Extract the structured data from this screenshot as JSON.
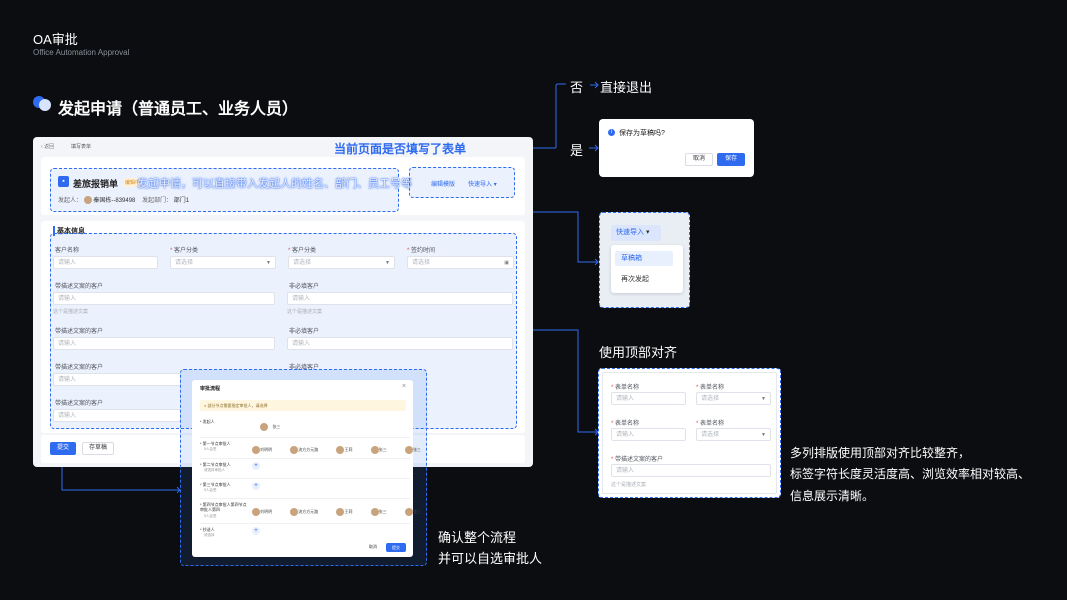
{
  "header": {
    "title": "OA审批",
    "subtitle": "Office Automation Approval"
  },
  "section": {
    "title": "发起申请（普通员工、业务人员）"
  },
  "annotations": {
    "current_page_question": "当前页面是否填写了表单",
    "no_label": "否",
    "no_action": "直接退出",
    "yes_label": "是",
    "top_align": "使用顶部对齐",
    "top_align_desc_1": "多列排版使用顶部对齐比较整齐，",
    "top_align_desc_2": "标签字符长度灵活度高、浏览效率相对较高、",
    "top_align_desc_3": "信息展示清晰。",
    "confirm_flow_1": "确认整个流程",
    "confirm_flow_2": "并可以自选审批人",
    "auto_fill_note": "发起申请，可以直接带入发起人的姓名、部门、员工号等"
  },
  "form_page": {
    "back": "返回",
    "breadcrumb": "填写表单",
    "form_title": "差旅报销单",
    "status_badge": "编辑中",
    "initiator_label": "发起人：",
    "initiator_name": "秦国栋--839498",
    "dept_label": "发起部门：",
    "dept_name": "部门1",
    "edit_template": "编辑模版",
    "quick_import": "快速导入",
    "basic_info": "基本信息",
    "fields": {
      "customer_name": "客户名称",
      "customer_type_1": "客户分类",
      "customer_type_2": "客户分类",
      "sign_time": "签约时间",
      "placeholder_input": "请输入",
      "placeholder_select": "请选择",
      "desc_customer": "带描述文案的客户",
      "optional_customer": "非必填客户",
      "desc_hint": "这个是描述文案"
    },
    "submit": "提交",
    "save_draft": "存草稿"
  },
  "save_dialog": {
    "title": "保存为草稿吗?",
    "cancel": "取消",
    "save": "保存"
  },
  "quick_import_menu": {
    "button": "快速导入",
    "items": [
      "草稿箱",
      "再次发起"
    ]
  },
  "top_align_demo": {
    "field_name": "表单名称",
    "placeholder_input": "请输入",
    "placeholder_select": "请选择",
    "desc_customer": "带描述文案的客户",
    "desc_hint": "这个是描述文案"
  },
  "approval_dialog": {
    "title": "审批流程",
    "notice": "部分节点需要指定审批人，请选择",
    "nodes": [
      {
        "name": "发起人",
        "sub": "",
        "people": [
          "张三"
        ]
      },
      {
        "name": "第一节点审批人",
        "sub": "5人会签",
        "people": [
          "刘明明",
          "流方方元路",
          "王莉",
          "张三",
          "张三"
        ]
      },
      {
        "name": "第二节点审批人",
        "sub": "请选择审批人",
        "people": []
      },
      {
        "name": "第三节点审批人",
        "sub": "5人会签",
        "people": []
      },
      {
        "name": "第四节点审批人第四节点审批人第四",
        "sub": "5人会签",
        "people": [
          "刘明明",
          "流方方元路",
          "王莉",
          "张三",
          "张三"
        ]
      },
      {
        "name": "抄送人",
        "sub": "请选择",
        "people": []
      }
    ],
    "cancel": "取消",
    "submit": "提交"
  },
  "colors": {
    "accent": "#2f6bf0",
    "background": "#0c0d10",
    "panel": "#f3f5f9"
  }
}
